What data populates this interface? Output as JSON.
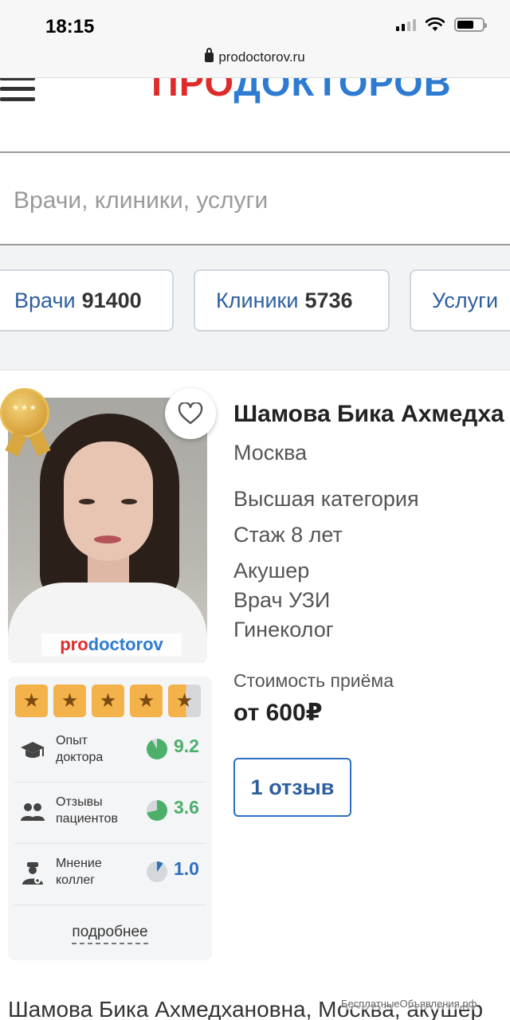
{
  "status_bar": {
    "time": "18:15"
  },
  "browser": {
    "url": "prodoctorov.ru"
  },
  "header": {
    "logo_part1": "ПРО",
    "logo_part2": "ДОКТОРОВ"
  },
  "search": {
    "placeholder": "Врачи, клиники, услуги"
  },
  "categories": [
    {
      "label": "Врачи",
      "count": "91400"
    },
    {
      "label": "Клиники",
      "count": "5736"
    },
    {
      "label": "Услуги",
      "count": ""
    }
  ],
  "doctor": {
    "name": "Шамова Бика Ахмедха",
    "city": "Москва",
    "category": "Высшая категория",
    "experience": "Стаж 8 лет",
    "specialties": [
      "Акушер",
      "Врач УЗИ",
      "Гинеколог"
    ],
    "photo_logo_part1": "pro",
    "photo_logo_part2": "doctorov",
    "price_label": "Стоимость приёма",
    "price": "от 600₽",
    "reviews_button": "1 отзыв",
    "rating_stars": 4.5
  },
  "metrics": [
    {
      "label_line1": "Опыт",
      "label_line2": "доктора",
      "value": "9.2",
      "fraction": 0.92,
      "color": "#4caf6a",
      "icon": "graduation-cap-icon"
    },
    {
      "label_line1": "Отзывы",
      "label_line2": "пациентов",
      "value": "3.6",
      "fraction": 0.72,
      "color": "#4caf6a",
      "icon": "patients-icon"
    },
    {
      "label_line1": "Мнение",
      "label_line2": "коллег",
      "value": "1.0",
      "fraction": 0.1,
      "color": "#2d6fc0",
      "icon": "doctor-icon"
    }
  ],
  "more_link": "подробнее",
  "bottom_text": "Шамова Бика Ахмедхановна, Москва, акушер",
  "watermark": "БесплатныеОбъявления.рф",
  "colors": {
    "brand_red": "#e02b2b",
    "brand_blue": "#2d7cd1",
    "link_blue": "#2d5fa0",
    "star": "#f3b24a"
  }
}
